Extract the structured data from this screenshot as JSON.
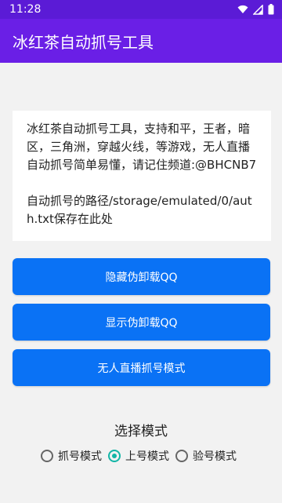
{
  "status_bar": {
    "time": "11:28",
    "icons": [
      "wifi-icon",
      "signal-icon",
      "battery-icon"
    ]
  },
  "app_bar": {
    "title": "冰红茶自动抓号工具"
  },
  "info_card": {
    "line1": "冰红茶自动抓号工具，支持和平，王者，暗区，三角洲，穿越火线，等游戏，无人直播自动抓号简单易懂，请记住频道:@BHCNB7",
    "line2": "自动抓号的路径/storage/emulated/0/auth.txt保存在此处"
  },
  "buttons": {
    "hide_uninstall": "隐藏伪卸载QQ",
    "show_uninstall": "显示伪卸载QQ",
    "live_mode": "无人直播抓号模式"
  },
  "mode": {
    "title": "选择模式",
    "options": [
      {
        "label": "抓号模式",
        "checked": false
      },
      {
        "label": "上号模式",
        "checked": true
      },
      {
        "label": "验号模式",
        "checked": false
      }
    ]
  },
  "colors": {
    "status_bar": "#5b1bd6",
    "app_bar": "#6a1fe6",
    "button": "#0a72f5",
    "radio_checked": "#12b5a6"
  }
}
